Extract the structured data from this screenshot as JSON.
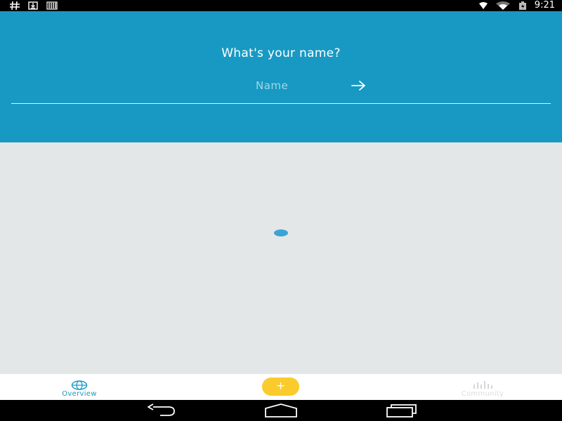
{
  "status_bar": {
    "left_icons": [
      "hash-icon",
      "download-icon",
      "storage-icon"
    ],
    "right_icons": [
      "signal-icon",
      "wifi-icon",
      "battery-icon"
    ],
    "time": "9:21"
  },
  "header": {
    "title": "What's your name?",
    "name_input": {
      "placeholder": "Name",
      "value": ""
    },
    "next_icon": "arrow-right-icon",
    "background_color": "#1899c3"
  },
  "content": {
    "background_color": "#e4e7e7",
    "loading_indicator_color": "#3aa3d6"
  },
  "tab_bar": {
    "tabs": [
      {
        "label": "Overview",
        "icon": "globe-icon",
        "active": true
      },
      {
        "label": "Community",
        "icon": "bar-chart-icon",
        "active": false
      }
    ],
    "add_button": {
      "label": "+",
      "color": "#fbcb2d"
    }
  },
  "nav_bar": {
    "buttons": [
      "back-icon",
      "home-icon",
      "recents-icon"
    ]
  }
}
